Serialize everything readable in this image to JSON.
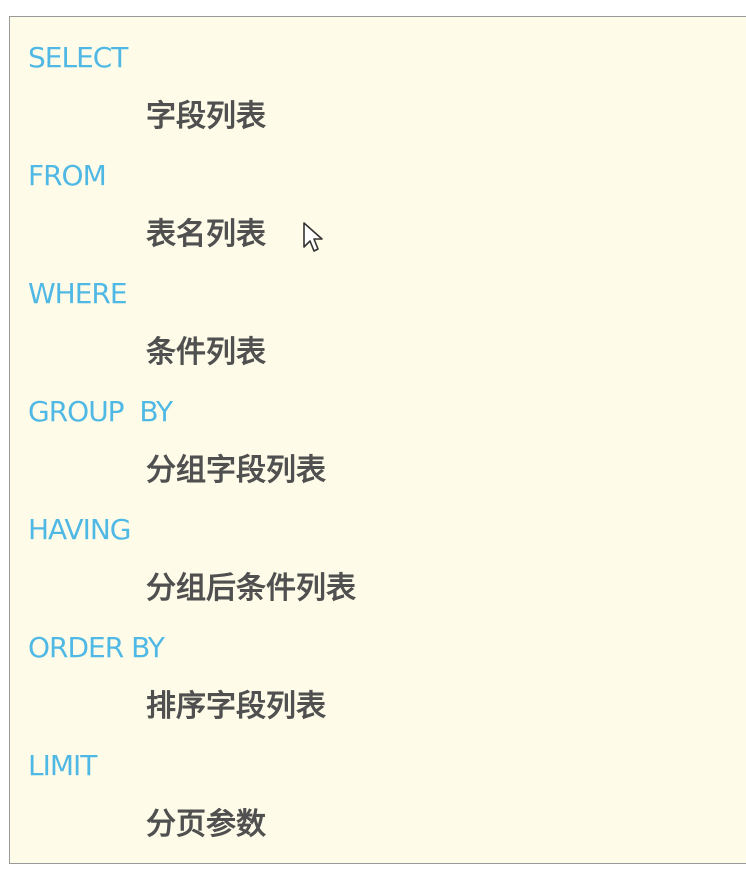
{
  "clauses": [
    {
      "keyword": "SELECT",
      "argument": "字段列表"
    },
    {
      "keyword": "FROM",
      "argument": "表名列表"
    },
    {
      "keyword": "WHERE",
      "argument": "条件列表"
    },
    {
      "keyword": "GROUP  BY",
      "argument": "分组字段列表"
    },
    {
      "keyword": "HAVING",
      "argument": "分组后条件列表"
    },
    {
      "keyword": "ORDER BY",
      "argument": "排序字段列表"
    },
    {
      "keyword": "LIMIT",
      "argument": "分页参数"
    }
  ],
  "colors": {
    "keyword": "#4fb8e4",
    "argument": "#505050",
    "background": "#fefce9"
  },
  "cursor_icon": "mouse-pointer-icon"
}
